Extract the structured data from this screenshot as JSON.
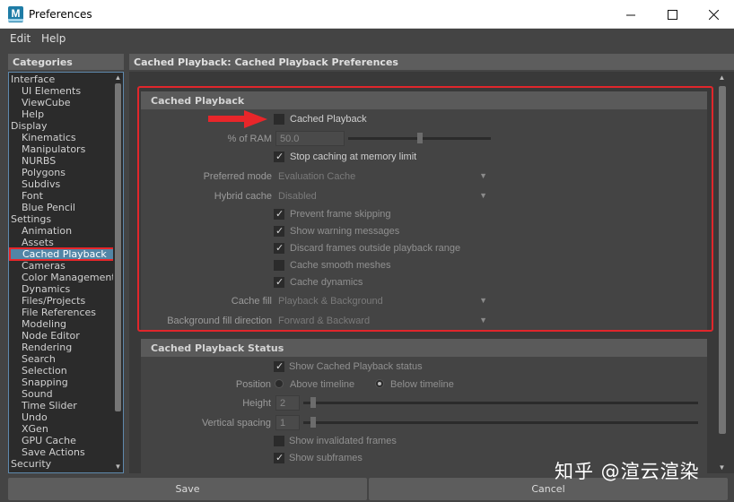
{
  "window": {
    "title": "Preferences",
    "app_icon": "maya-icon",
    "icon_letter": "M"
  },
  "menu": [
    "Edit",
    "Help"
  ],
  "categories": {
    "header": "Categories",
    "items": [
      {
        "label": "Interface",
        "level": 0
      },
      {
        "label": "UI Elements",
        "level": 1
      },
      {
        "label": "ViewCube",
        "level": 1
      },
      {
        "label": "Help",
        "level": 1
      },
      {
        "label": "Display",
        "level": 0
      },
      {
        "label": "Kinematics",
        "level": 1
      },
      {
        "label": "Manipulators",
        "level": 1
      },
      {
        "label": "NURBS",
        "level": 1
      },
      {
        "label": "Polygons",
        "level": 1
      },
      {
        "label": "Subdivs",
        "level": 1
      },
      {
        "label": "Font",
        "level": 1
      },
      {
        "label": "Blue Pencil",
        "level": 1
      },
      {
        "label": "Settings",
        "level": 0
      },
      {
        "label": "Animation",
        "level": 1
      },
      {
        "label": "Assets",
        "level": 1
      },
      {
        "label": "Cached Playback",
        "level": 1,
        "selected": true
      },
      {
        "label": "Cameras",
        "level": 1
      },
      {
        "label": "Color Management",
        "level": 1
      },
      {
        "label": "Dynamics",
        "level": 1
      },
      {
        "label": "Files/Projects",
        "level": 1
      },
      {
        "label": "File References",
        "level": 1
      },
      {
        "label": "Modeling",
        "level": 1
      },
      {
        "label": "Node Editor",
        "level": 1
      },
      {
        "label": "Rendering",
        "level": 1
      },
      {
        "label": "Search",
        "level": 1
      },
      {
        "label": "Selection",
        "level": 1
      },
      {
        "label": "Snapping",
        "level": 1
      },
      {
        "label": "Sound",
        "level": 1
      },
      {
        "label": "Time Slider",
        "level": 1
      },
      {
        "label": "Undo",
        "level": 1
      },
      {
        "label": "XGen",
        "level": 1
      },
      {
        "label": "GPU Cache",
        "level": 1
      },
      {
        "label": "Save Actions",
        "level": 1
      },
      {
        "label": "Security",
        "level": 0
      }
    ]
  },
  "pane": {
    "header": "Cached Playback: Cached Playback Preferences"
  },
  "cached_playback": {
    "title": "Cached Playback",
    "enable": {
      "label": "Cached Playback",
      "checked": false
    },
    "ram": {
      "label": "% of RAM",
      "value": "50.0",
      "level": 0.5
    },
    "stop_caching": {
      "label": "Stop caching at memory limit",
      "checked": true
    },
    "preferred_mode": {
      "label": "Preferred mode",
      "value": "Evaluation Cache"
    },
    "hybrid_cache": {
      "label": "Hybrid cache",
      "value": "Disabled"
    },
    "prevent_skip": {
      "label": "Prevent frame skipping",
      "checked": true
    },
    "show_warning": {
      "label": "Show warning messages",
      "checked": true
    },
    "discard_frames": {
      "label": "Discard frames outside playback range",
      "checked": true
    },
    "smooth_meshes": {
      "label": "Cache smooth meshes",
      "checked": false
    },
    "cache_dynamics": {
      "label": "Cache dynamics",
      "checked": true
    },
    "cache_fill": {
      "label": "Cache fill",
      "value": "Playback & Background"
    },
    "bg_fill_dir": {
      "label": "Background fill direction",
      "value": "Forward & Backward"
    }
  },
  "status": {
    "title": "Cached Playback Status",
    "show_status": {
      "label": "Show Cached Playback status",
      "checked": true
    },
    "position": {
      "label": "Position",
      "opt1": "Above timeline",
      "opt2": "Below timeline",
      "selected": "Below timeline"
    },
    "height": {
      "label": "Height",
      "value": "2"
    },
    "vspacing": {
      "label": "Vertical spacing",
      "value": "1"
    },
    "invalidated": {
      "label": "Show invalidated frames",
      "checked": false
    },
    "subframes": {
      "label": "Show subframes",
      "checked": true
    }
  },
  "buttons": {
    "save": "Save",
    "cancel": "Cancel"
  },
  "watermark": "知乎 @渲云渲染",
  "colors": {
    "highlight": "#e0262b",
    "selection": "#5285a6"
  }
}
